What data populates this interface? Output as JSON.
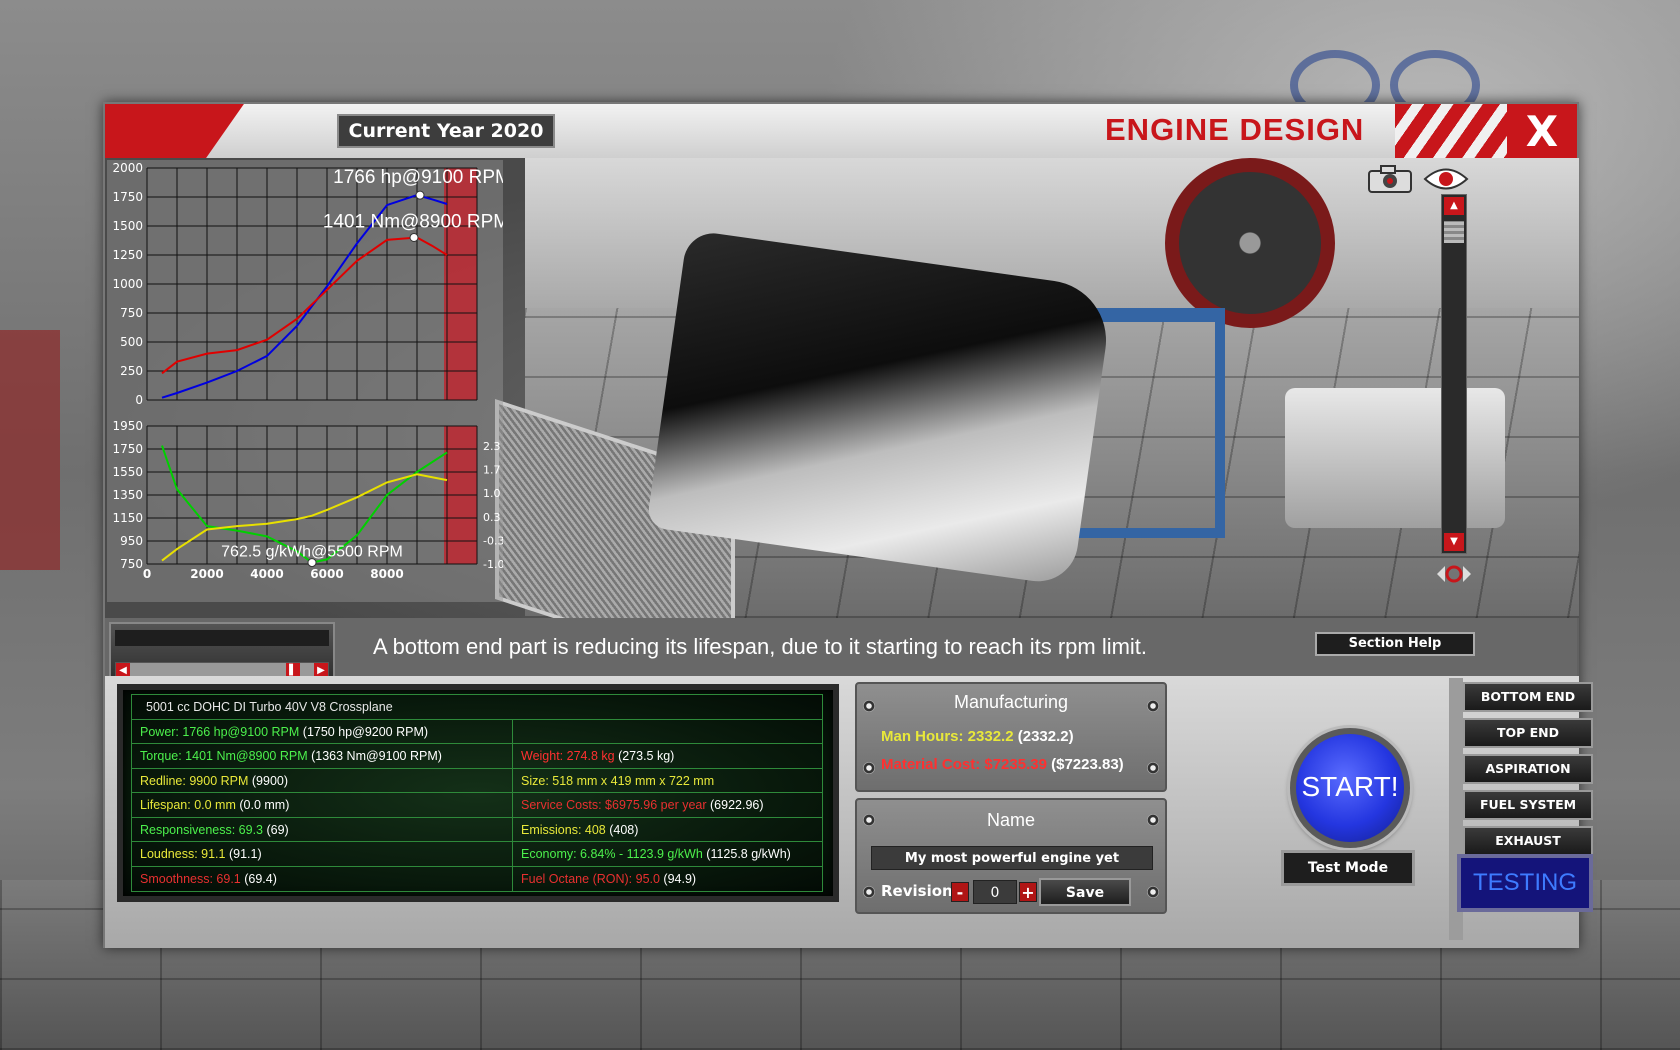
{
  "window": {
    "year_label": "Current Year 2020",
    "title": "ENGINE DESIGN",
    "close_label": "X"
  },
  "message": "A bottom end part is reducing its lifespan, due to it starting to reach its rpm limit.",
  "section_help_label": "Section Help",
  "stats": {
    "engine_desc": "5001 cc DOHC DI Turbo 40V V8 Crossplane",
    "rows": [
      {
        "left_label": "Power: 1766 hp@9100 RPM",
        "left_extra": " (1750 hp@9200 RPM)",
        "right_label": "",
        "right_extra": ""
      },
      {
        "left_label": "Torque: 1401 Nm@8900 RPM",
        "left_extra": " (1363 Nm@9100 RPM)",
        "right_label": "Weight: 274.8 kg",
        "right_extra": " (273.5 kg)"
      },
      {
        "left_label": "Redline: 9900 RPM",
        "left_extra": " (9900)",
        "right_label": "Size: 518 mm x 419 mm x 722 mm",
        "right_extra": ""
      },
      {
        "left_label": "Lifespan: 0.0 mm",
        "left_extra": " (0.0 mm)",
        "right_label": "Service Costs: $6975.96 per year",
        "right_extra": " (6922.96)"
      },
      {
        "left_label": "Responsiveness: 69.3",
        "left_extra": " (69)",
        "right_label": "Emissions: 408",
        "right_extra": " (408)"
      },
      {
        "left_label": "Loudness: 91.1",
        "left_extra": " (91.1)",
        "right_label": "Economy: 6.84% - 1123.9 g/kWh",
        "right_extra": " (1125.8 g/kWh)"
      },
      {
        "left_label": "Smoothness: 69.1",
        "left_extra": " (69.4)",
        "right_label": "Fuel Octane (RON): 95.0",
        "right_extra": " (94.9)"
      }
    ]
  },
  "manufacturing": {
    "title": "Manufacturing",
    "man_hours_label": "Man Hours: ",
    "man_hours_value": "2332.2",
    "man_hours_prev": " (2332.2)",
    "material_label": "Material Cost: ",
    "material_value": "$7235.39",
    "material_prev": " ($7223.83)"
  },
  "name_panel": {
    "title": "Name",
    "engine_name": "My most powerful engine yet",
    "revision_label": "Revision",
    "revision_minus": "-",
    "revision_value": "0",
    "revision_plus": "+",
    "save_label": "Save"
  },
  "start_label": "START!",
  "test_mode_label": "Test Mode",
  "nav": {
    "bottom_end": "BOTTOM END",
    "top_end": "TOP END",
    "aspiration": "ASPIRATION",
    "fuel_system": "FUEL SYSTEM",
    "exhaust": "EXHAUST",
    "testing": "TESTING"
  },
  "chart_data": [
    {
      "type": "line",
      "x": [
        500,
        1000,
        2000,
        3000,
        4000,
        5000,
        6000,
        7000,
        8000,
        9000,
        9500,
        10000
      ],
      "series": [
        {
          "color": "#0000e0",
          "values": [
            20,
            60,
            150,
            250,
            380,
            640,
            980,
            1350,
            1680,
            1766,
            1730,
            1690
          ]
        },
        {
          "color": "#e00000",
          "values": [
            230,
            330,
            400,
            430,
            520,
            700,
            950,
            1200,
            1380,
            1401,
            1330,
            1250
          ]
        }
      ],
      "annotations": [
        "1766 hp@9100 RPM",
        "1401 Nm@8900 RPM"
      ],
      "yticks": [
        "2000",
        "1750",
        "1500",
        "1250",
        "1000",
        "750",
        "500",
        "250",
        "0"
      ],
      "ylim": [
        0,
        2000
      ],
      "xlim": [
        0,
        11000
      ],
      "redline_start": 9900,
      "grid": true
    },
    {
      "type": "line",
      "x": [
        500,
        1000,
        2000,
        3000,
        4000,
        5000,
        5500,
        6000,
        7000,
        8000,
        9000,
        10000
      ],
      "series": [
        {
          "color": "#00d000",
          "axis": "left",
          "values": [
            1780,
            1400,
            1080,
            1040,
            990,
            860,
            762.5,
            790,
            1000,
            1350,
            1550,
            1720
          ]
        },
        {
          "color": "#e8e000",
          "axis": "left",
          "values": [
            780,
            880,
            1050,
            1080,
            1100,
            1140,
            1170,
            1220,
            1330,
            1460,
            1530,
            1480
          ]
        }
      ],
      "annotations": [
        "762.5 g/kWh@5500 RPM"
      ],
      "yticks": [
        "1950",
        "1750",
        "1550",
        "1350",
        "1150",
        "950",
        "750"
      ],
      "yticks_right": [
        "2.3",
        "1.7",
        "1.0",
        "0.3",
        "-0.3",
        "-1.0"
      ],
      "xticks": [
        "0",
        "2000",
        "4000",
        "6000",
        "8000"
      ],
      "ylim": [
        750,
        1950
      ],
      "xlim": [
        0,
        11000
      ],
      "redline_start": 9900,
      "grid": true
    }
  ]
}
